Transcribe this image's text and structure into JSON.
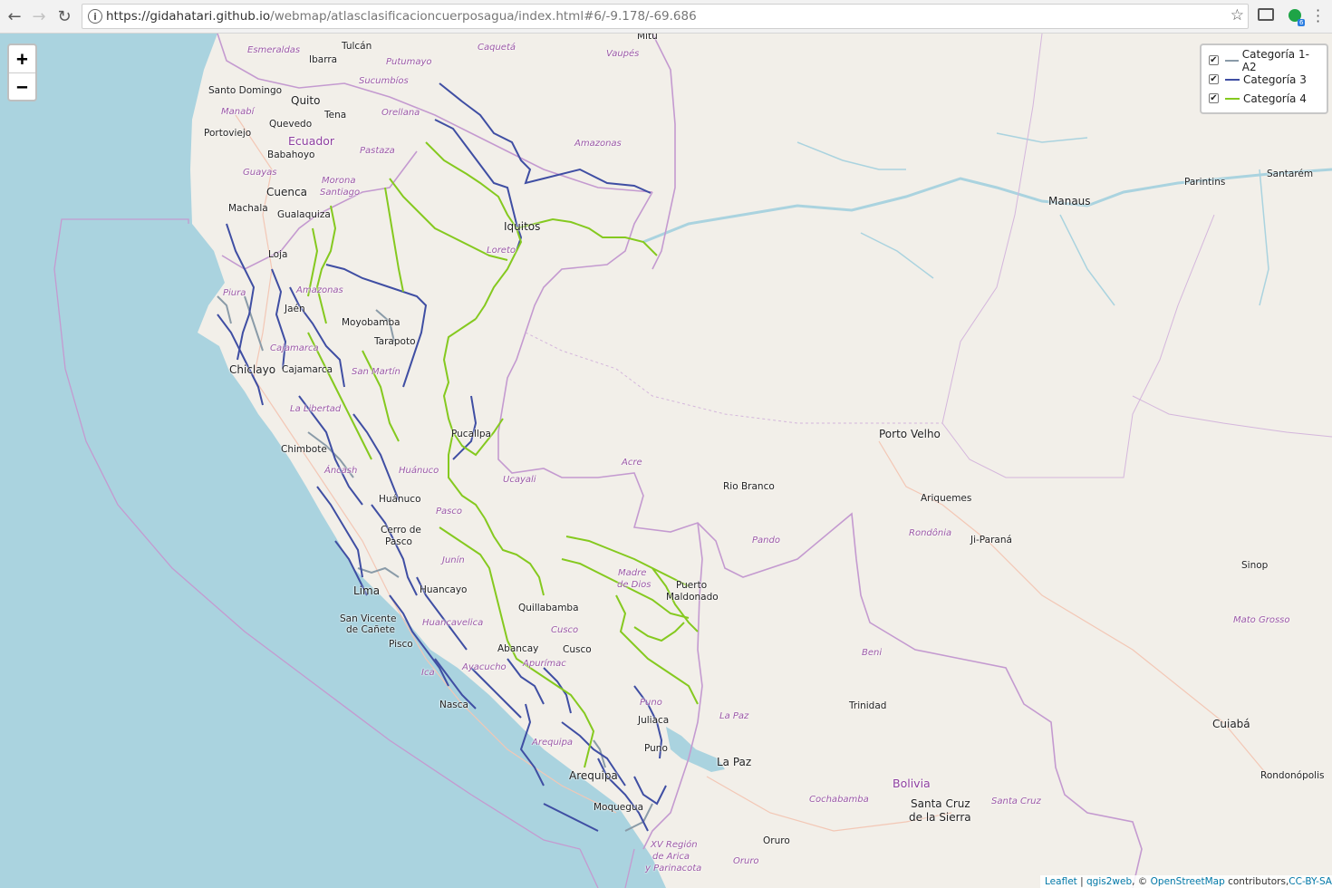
{
  "browser": {
    "url_host": "https://gidahatari.github.io",
    "url_path": "/webmap/atlasclasificacioncuerposagua/index.html#6/-9.178/-69.686",
    "extension_badge": "6"
  },
  "zoom": {
    "in_label": "+",
    "out_label": "−"
  },
  "legend": {
    "layers": [
      {
        "label": "Categoría 1-A2",
        "color": "#8a9ba8",
        "checked": "✔"
      },
      {
        "label": "Categoría 3",
        "color": "#3f4ea3",
        "checked": "✔"
      },
      {
        "label": "Categoría 4",
        "color": "#85c91f",
        "checked": "✔"
      }
    ]
  },
  "attribution": {
    "leaflet": "Leaflet",
    "sep": " | ",
    "qgis2web": "qgis2web",
    "copyright": ", © ",
    "osm": "OpenStreetMap",
    "contributors": " contributors,",
    "license": "CC-BY-SA"
  },
  "map": {
    "colors": {
      "ocean": "#aad3df",
      "land": "#f2efe9",
      "border": "#c49ad0",
      "water_inland": "#aad3df"
    },
    "places": [
      "Tulcán",
      "Esmeraldas",
      "Ibarra",
      "Santo Domingo",
      "Quito",
      "Tena",
      "Portoviejo",
      "Quevedo",
      "Ecuador",
      "Babahoyo",
      "Cuenca",
      "Machala",
      "Gualaquiza",
      "Loja",
      "Jaén",
      "Moyobamba",
      "Tarapoto",
      "Chiclayo",
      "Cajamarca",
      "Chimbote",
      "Huánuco",
      "Pucallpa",
      "Cerro de",
      "Pasco",
      "Huancayo",
      "Lima",
      "San Vicente",
      "de Cañete",
      "Pisco",
      "Nasca",
      "Abancay",
      "Cusco",
      "Quillabamba",
      "Puerto",
      "Maldonado",
      "Juliaca",
      "Puno",
      "Arequipa",
      "Moquegua",
      "La Paz",
      "Iquitos",
      "Manaus",
      "Parintins",
      "Santarém",
      "Porto Velho",
      "Rio Branco",
      "Ariquemes",
      "Ji-Paraná",
      "Sinop",
      "Trinidad",
      "Cuiabá",
      "Rondonópolis",
      "Santa Cruz",
      "de la Sierra",
      "Oruro",
      "Bolivia",
      "Mitú"
    ],
    "regions": [
      "Caquetá",
      "Putumayo",
      "Vaupés",
      "Sucumbíos",
      "Orellana",
      "Manabí",
      "Pastaza",
      "Guayas",
      "Morona",
      "Santiago",
      "Amazonas",
      "Loreto",
      "Piura",
      "Amazonas",
      "Cajamarca",
      "San Martín",
      "La Libertad",
      "Áncash",
      "Huánuco",
      "Ucayali",
      "Acre",
      "Pasco",
      "Junín",
      "Madre",
      "de Dios",
      "Pando",
      "Rondônia",
      "Mato Grosso",
      "Huancavelica",
      "Ayacucho",
      "Apurímac",
      "Cusco",
      "Ica",
      "Arequipa",
      "Puno",
      "La Paz",
      "Beni",
      "Cochabamba",
      "Santa Cruz",
      "XV Región",
      "de Arica",
      "y Parinacota",
      "Oruro"
    ]
  }
}
